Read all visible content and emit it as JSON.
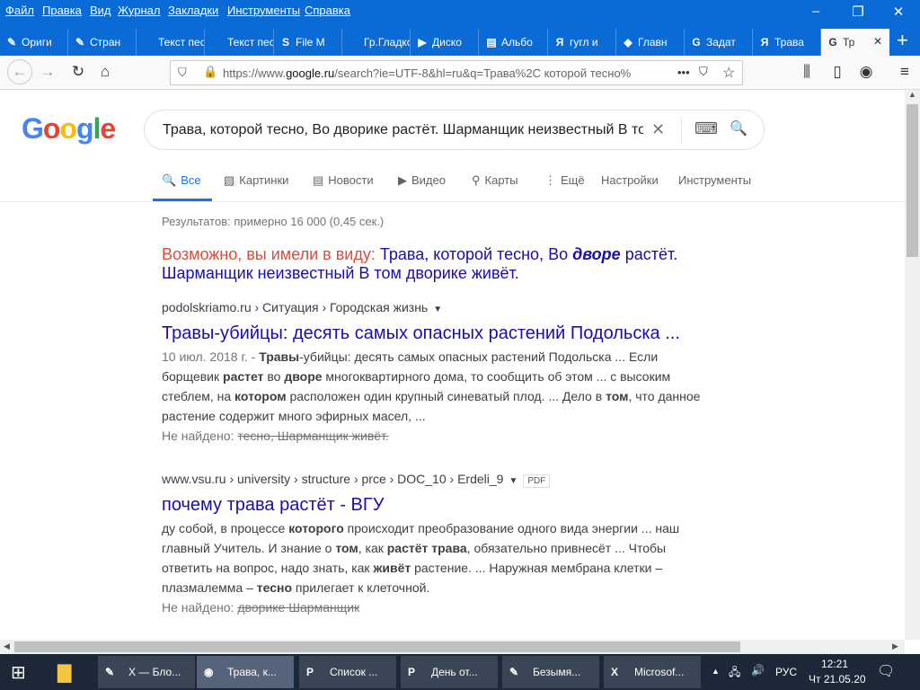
{
  "menu": [
    "Файл",
    "Правка",
    "Вид",
    "Журнал",
    "Закладки",
    "Инструменты",
    "Справка"
  ],
  "window_controls": {
    "minimize": "–",
    "restore": "❐",
    "close": "✕"
  },
  "tabs": [
    {
      "icon": "✎",
      "label": "Ориги"
    },
    {
      "icon": "✎",
      "label": "Стран"
    },
    {
      "icon": "",
      "label": "Текст песі"
    },
    {
      "icon": "",
      "label": "Текст песі"
    },
    {
      "icon": "S",
      "label": "File M"
    },
    {
      "icon": "",
      "label": "Гр.Гладко"
    },
    {
      "icon": "▶",
      "label": "Диско"
    },
    {
      "icon": "▤",
      "label": "Альбо"
    },
    {
      "icon": "Я",
      "label": "гугл и"
    },
    {
      "icon": "◆",
      "label": "Главн"
    },
    {
      "icon": "G",
      "label": "Задат"
    },
    {
      "icon": "Я",
      "label": "Трава"
    },
    {
      "icon": "G",
      "label": "Тр"
    }
  ],
  "new_tab": "+",
  "tab_close": "✕",
  "url": {
    "prefix": "https://www.",
    "domain": "google.ru",
    "rest": "/search?ie=UTF-8&hl=ru&q=Трава%2C которой тесно%"
  },
  "logo": "Google",
  "colors": {
    "g_blue": "#4285f4",
    "g_red": "#ea4335",
    "g_yellow": "#fbbc05",
    "g_green": "#34a853"
  },
  "search": {
    "query": "Трава, которой тесно, Во дворике растёт. Шарманщик неизвестный В то",
    "clear": "✕",
    "kbd": "⌨",
    "submit": "🔍"
  },
  "gtabs": [
    {
      "icon": "🔍",
      "label": "Все"
    },
    {
      "icon": "▨",
      "label": "Картинки"
    },
    {
      "icon": "▤",
      "label": "Новости"
    },
    {
      "icon": "▶",
      "label": "Видео"
    },
    {
      "icon": "⚲",
      "label": "Карты"
    },
    {
      "icon": "⋮",
      "label": "Ещё"
    },
    {
      "icon": "",
      "label": "Настройки"
    },
    {
      "icon": "",
      "label": "Инструменты"
    }
  ],
  "stats": "Результатов: примерно 16 000 (0,45 сек.)",
  "dym": {
    "label": "Возможно, вы имели в виду:",
    "p1": "Трава, которой тесно, Во",
    "bold": "дворе",
    "p2": "растёт. Шарманщик неизвестный В том дворике живёт."
  },
  "results": [
    {
      "url": "podolskriamo.ru › Ситуация › Городская жизнь",
      "arrow": "▼",
      "title": "Травы-убийцы: десять самых опасных растений Подольска ...",
      "date": "10 июл. 2018 г. - ",
      "snippet": [
        [
          "Травы",
          1
        ],
        [
          "-убийцы: десять самых опасных растений Подольска ... Если борщевик ",
          0
        ],
        [
          "растет",
          1
        ],
        [
          " во ",
          0
        ],
        [
          "дворе",
          1
        ],
        [
          " многоквартирного дома, то сообщить об этом ... с высоким стеблем, на ",
          0
        ],
        [
          "котором",
          1
        ],
        [
          " расположен один крупный синеватый плод. ... Дело в ",
          0
        ],
        [
          "том",
          1
        ],
        [
          ", что данное растение содержит много эфирных масел, ...",
          0
        ]
      ],
      "nf_label": "Не найдено:",
      "nf": "тесно, Шарманщик живёт."
    },
    {
      "url": "www.vsu.ru › university › structure › prce › DOC_10 › Erdeli_9",
      "arrow": "▼",
      "badge": "PDF",
      "title": "почему трава растёт - ВГУ",
      "date": "",
      "snippet": [
        [
          "ду собой, в процессе ",
          0
        ],
        [
          "которого",
          1
        ],
        [
          " происходит преобразование одного вида энергии ... наш главный Учитель. И знание о ",
          0
        ],
        [
          "том",
          1
        ],
        [
          ", как ",
          0
        ],
        [
          "растёт трава",
          1
        ],
        [
          ", обязательно привнесёт ... Чтобы ответить на вопрос, надо знать, как ",
          0
        ],
        [
          "живёт",
          1
        ],
        [
          " растение. ... Наружная мембрана клетки – плазмалемма – ",
          0
        ],
        [
          "тесно",
          1
        ],
        [
          " прилегает к клеточной.",
          0
        ]
      ],
      "nf_label": "Не найдено:",
      "nf": "дворике Шарманщик"
    }
  ],
  "taskbar": [
    {
      "icon": "✎",
      "label": "Х — Бло..."
    },
    {
      "icon": "◉",
      "label": "Трава, к..."
    },
    {
      "icon": "P",
      "label": "Список ..."
    },
    {
      "icon": "P",
      "label": "День от..."
    },
    {
      "icon": "✎",
      "label": "Безымя..."
    },
    {
      "icon": "X",
      "label": "Microsof..."
    }
  ],
  "tray": {
    "arrow": "▲",
    "net": "🖧",
    "vol": "🔊",
    "lang": "РУС",
    "time": "12:21",
    "date": "Чт 21.05.20",
    "notif": "🗨"
  }
}
